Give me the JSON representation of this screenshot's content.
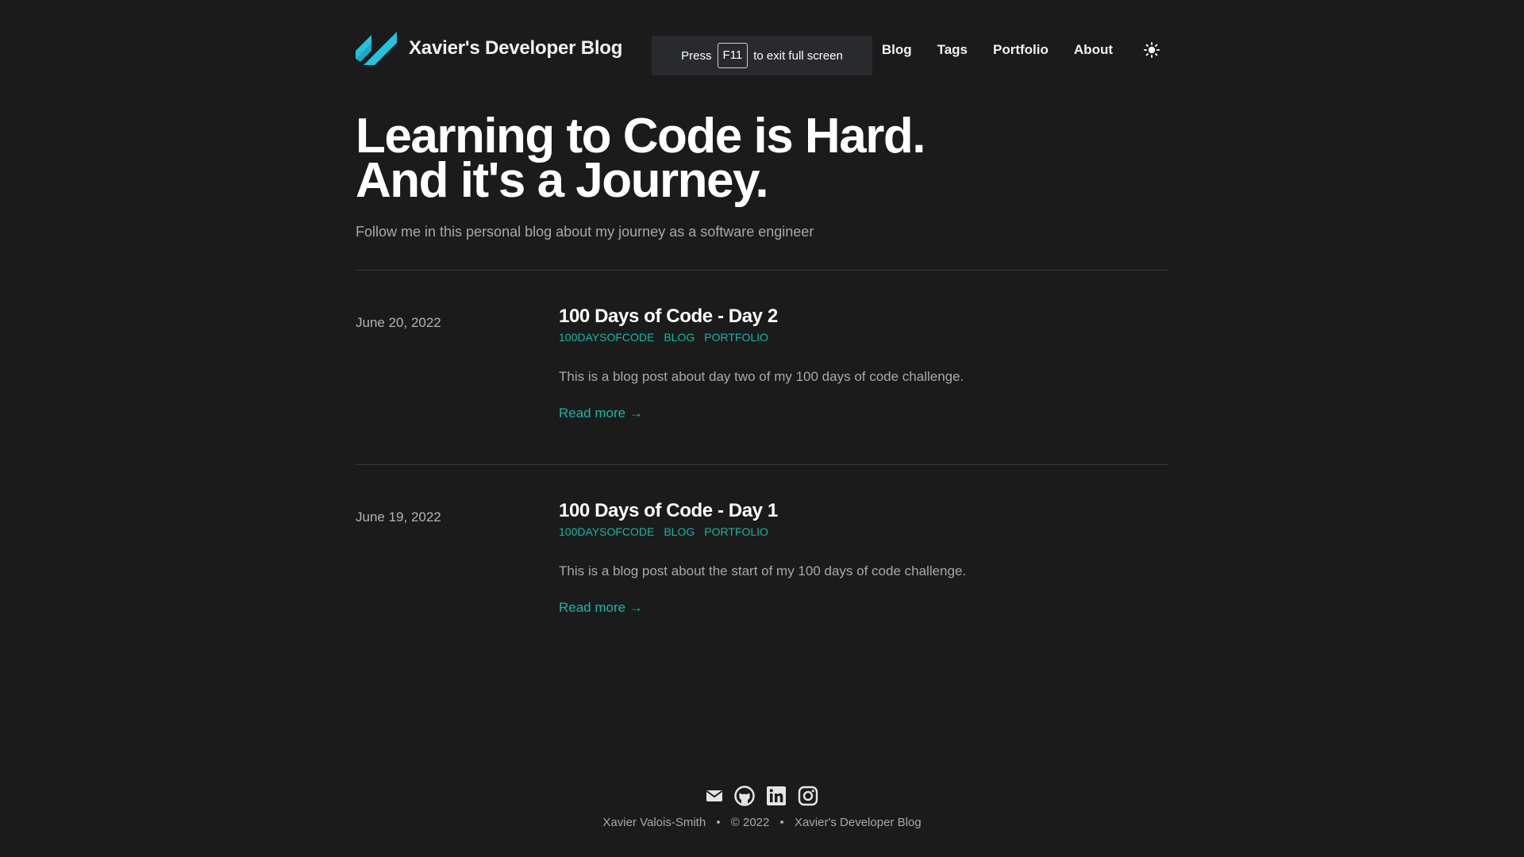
{
  "header": {
    "site_title": "Xavier's Developer Blog",
    "nav": [
      {
        "label": "Blog"
      },
      {
        "label": "Tags"
      },
      {
        "label": "Portfolio"
      },
      {
        "label": "About"
      }
    ],
    "theme_toggle_icon": "sun-icon"
  },
  "fullscreen_toast": {
    "prefix": "Press",
    "key": "F11",
    "suffix": "to exit full screen"
  },
  "hero": {
    "title_line1": "Learning to Code is Hard.",
    "title_line2": "And it's a Journey.",
    "subtitle": "Follow me in this personal blog about my journey as a software engineer"
  },
  "posts": [
    {
      "date": "June 20, 2022",
      "title": "100 Days of Code - Day 2",
      "tags": [
        "100DAYSOFCODE",
        "BLOG",
        "PORTFOLIO"
      ],
      "summary": "This is a blog post about day two of my 100 days of code challenge.",
      "read_more": "Read more →"
    },
    {
      "date": "June 19, 2022",
      "title": "100 Days of Code - Day 1",
      "tags": [
        "100DAYSOFCODE",
        "BLOG",
        "PORTFOLIO"
      ],
      "summary": "This is a blog post about the start of my 100 days of code challenge.",
      "read_more": "Read more →"
    }
  ],
  "footer": {
    "icons": [
      "mail-icon",
      "github-icon",
      "linkedin-icon",
      "instagram-icon"
    ],
    "author": "Xavier Valois-Smith",
    "separator": "•",
    "copyright": "© 2022",
    "site": "Xavier's Developer Blog"
  },
  "colors": {
    "background": "#1b1b1b",
    "accent": "#14b8a6",
    "logo": "#22c3dc"
  }
}
